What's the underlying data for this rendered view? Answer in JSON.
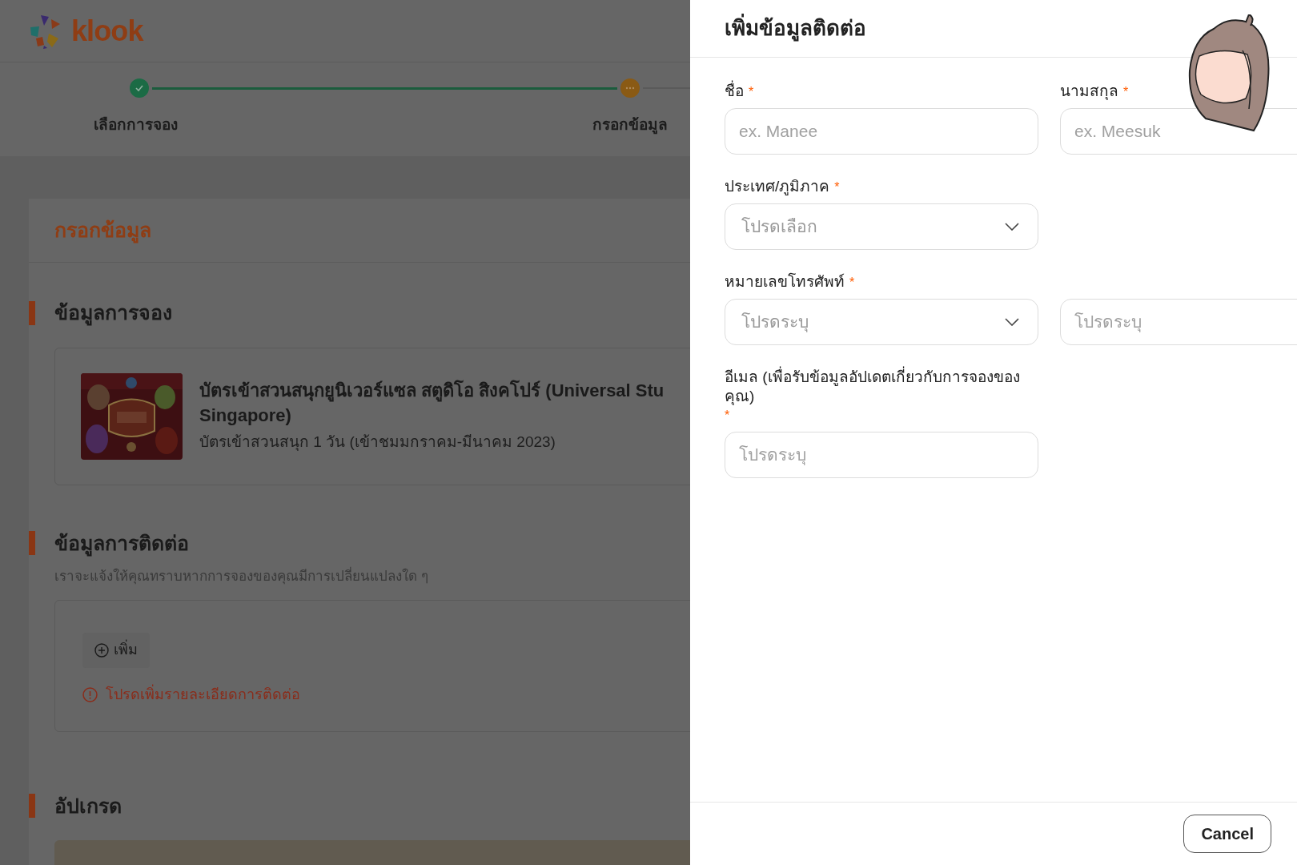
{
  "header": {
    "logo_text": "klook"
  },
  "steps": [
    {
      "label": "เลือกการจอง",
      "completed": true
    },
    {
      "label": "กรอกข้อมูล",
      "completed": false
    }
  ],
  "form_page": {
    "title": "กรอกข้อมูล",
    "booking": {
      "heading": "ข้อมูลการจอง",
      "product": {
        "title_lines": [
          "บัตรเข้าสวนสนุกยูนิเวอร์แซล สตูดิโอ สิงคโปร์ (Universal Stu",
          "Singapore)"
        ],
        "subtitle": "บัตรเข้าสวนสนุก 1 วัน (เข้าชมมกราคม-มีนาคม 2023)"
      }
    },
    "contact": {
      "heading": "ข้อมูลการติดต่อ",
      "description": "เราจะแจ้งให้คุณทราบหากการจองของคุณมีการเปลี่ยนแปลงใด ๆ",
      "add_button": "เพิ่ม",
      "error": "โปรดเพิ่มรายละเอียดการติดต่อ"
    },
    "upgrade": {
      "heading": "อัปเกรด"
    }
  },
  "drawer": {
    "title": "เพิ่มข้อมูลติดต่อ",
    "rows": [
      [
        {
          "label": "ชื่อ",
          "required_mark": "*",
          "control": {
            "kind": "text",
            "placeholder": "ex. Manee"
          }
        },
        {
          "label": "นามสกุล",
          "required_mark": "*",
          "control": {
            "kind": "text",
            "placeholder": "ex. Meesuk"
          }
        }
      ],
      [
        {
          "label": "ประเทศ/ภูมิภาค",
          "required_mark": "*",
          "control": {
            "kind": "select",
            "placeholder": "โปรดเลือก"
          }
        }
      ],
      [
        {
          "label": "หมายเลขโทรศัพท์",
          "required_mark": "*",
          "control": {
            "kind": "select",
            "placeholder": "โปรดระบุ"
          }
        },
        {
          "control": {
            "kind": "text",
            "placeholder": "โปรดระบุ"
          }
        }
      ],
      [
        {
          "label": "อีเมล (เพื่อรับข้อมูลอัปเดตเกี่ยวกับการจองของคุณ)",
          "required_mark": "*",
          "control": {
            "kind": "text",
            "placeholder": "โปรดระบุ"
          }
        }
      ]
    ],
    "cancel_button": "Cancel"
  }
}
